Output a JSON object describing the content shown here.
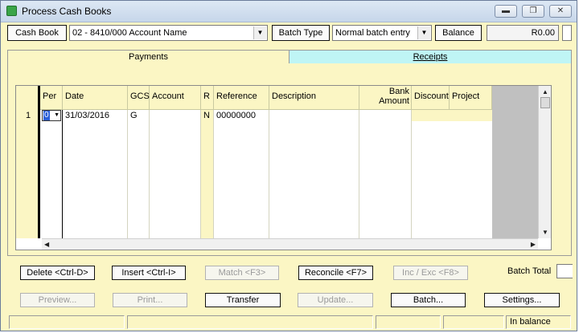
{
  "window": {
    "title": "Process Cash Books"
  },
  "toolbar": {
    "cash_book_label": "Cash Book",
    "account_value": "02 -  8410/000 Account Name",
    "batch_type_label": "Batch Type",
    "batch_type_value": "Normal batch entry",
    "balance_label": "Balance",
    "balance_value": "R0.00"
  },
  "tabs": [
    {
      "label": "Payments",
      "active": true
    },
    {
      "label": "Receipts",
      "active": false
    }
  ],
  "grid": {
    "columns": [
      "Per",
      "Date",
      "GCS",
      "Account",
      "R",
      "Reference",
      "Description",
      "Bank Amount",
      "Discount",
      "Project"
    ],
    "rows": [
      {
        "row_no": "1",
        "per": "0",
        "date": "31/03/2016",
        "gcs": "G",
        "account": "",
        "r": "N",
        "reference": "00000000",
        "description": "",
        "bank_amount": "",
        "discount": "",
        "project": ""
      }
    ]
  },
  "actions_row1": {
    "delete": "Delete <Ctrl-D>",
    "insert": "Insert <Ctrl-I>",
    "match": "Match <F3>",
    "reconcile": "Reconcile <F7>",
    "inc_exc": "Inc / Exc <F8>",
    "batch_total_label": "Batch Total"
  },
  "actions_row2": {
    "preview": "Preview...",
    "print": "Print...",
    "transfer": "Transfer",
    "update": "Update...",
    "batch": "Batch...",
    "settings": "Settings..."
  },
  "status": {
    "balance_state": "In balance"
  },
  "colors": {
    "panel_bg": "#fbf6c4",
    "receipts_tab": "#bff5f5"
  }
}
